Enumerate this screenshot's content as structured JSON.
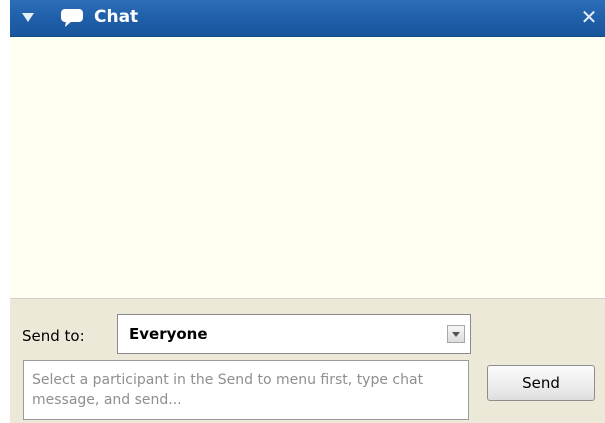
{
  "window": {
    "title": "Chat",
    "icons": {
      "collapse": "collapse-triangle-icon",
      "chat": "chat-bubble-icon",
      "close": "close-icon"
    },
    "colors": {
      "titlebar": "#1f5ea8",
      "message_area": "#fffff2",
      "composer": "#ece9d8"
    }
  },
  "composer": {
    "send_to_label": "Send to:",
    "send_to_selected": "Everyone",
    "message_placeholder": "Select a participant in the Send to menu first, type chat message, and send...",
    "message_value": "",
    "send_label": "Send"
  },
  "messages": []
}
